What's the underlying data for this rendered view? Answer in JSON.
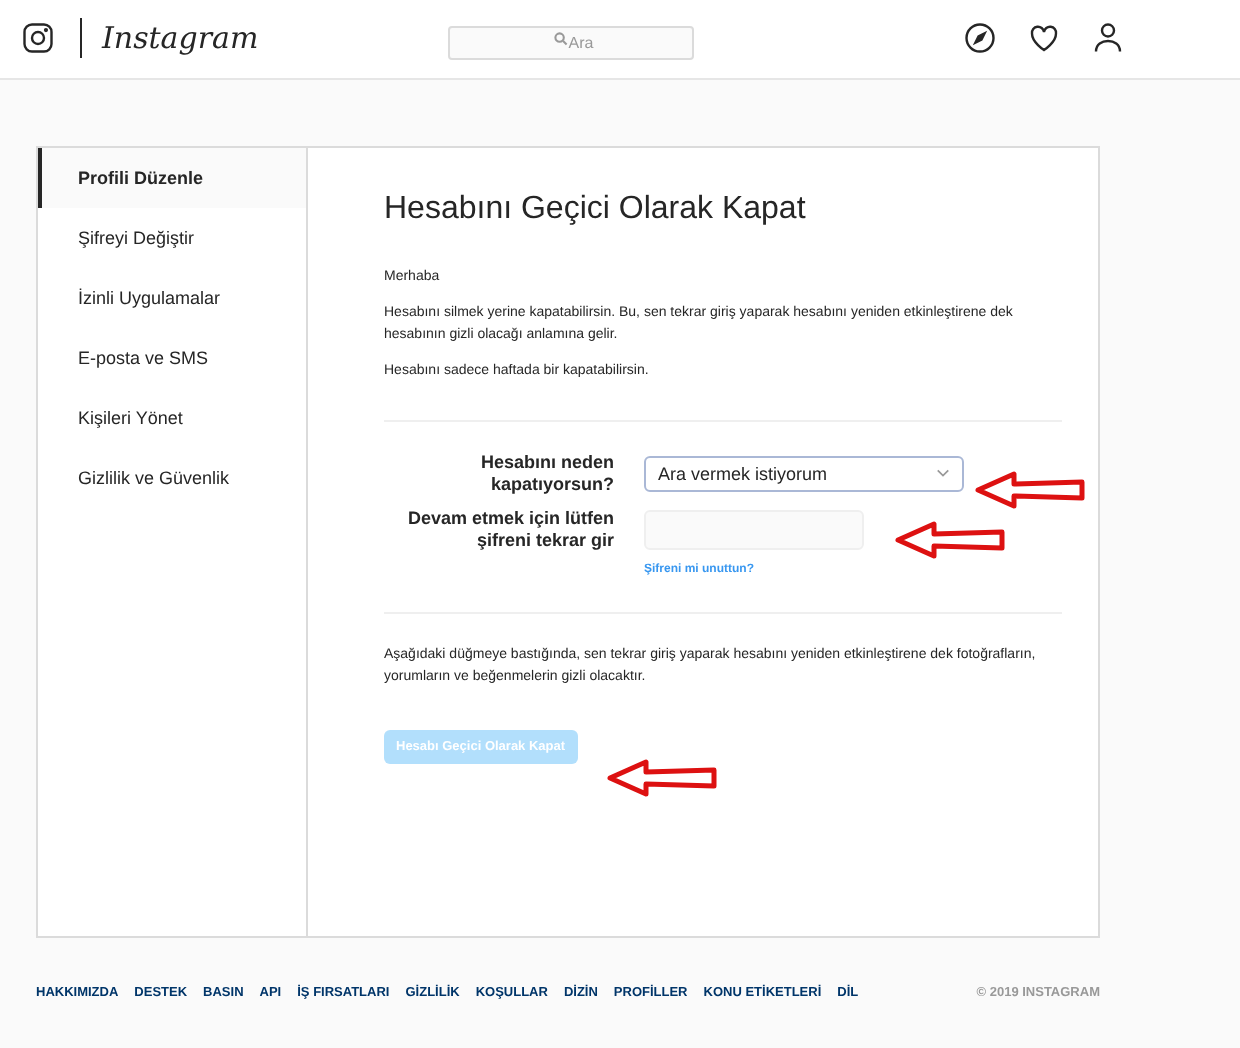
{
  "header": {
    "logo": "Instagram",
    "search": {
      "placeholder": "Ara"
    }
  },
  "sidebar": {
    "items": [
      {
        "label": "Profili Düzenle",
        "selected": true
      },
      {
        "label": "Şifreyi Değiştir",
        "selected": false
      },
      {
        "label": "İzinli Uygulamalar",
        "selected": false
      },
      {
        "label": "E-posta ve SMS",
        "selected": false
      },
      {
        "label": "Kişileri Yönet",
        "selected": false
      },
      {
        "label": "Gizlilik ve Güvenlik",
        "selected": false
      }
    ]
  },
  "main": {
    "title": "Hesabını Geçici Olarak Kapat",
    "greeting": "Merhaba",
    "paragraphs": [
      "Hesabını silmek yerine kapatabilirsin. Bu, sen tekrar giriş yaparak hesabını yeniden etkinleştirene dek hesabının gizli olacağı anlamına gelir.",
      "Hesabını sadece haftada bir kapatabilirsin."
    ],
    "reason": {
      "label": "Hesabını neden kapatıyorsun?",
      "value": "Ara vermek istiyorum"
    },
    "password": {
      "label": "Devam etmek için lütfen şifreni tekrar gir",
      "forgot_link": "Şifreni mi unuttun?"
    },
    "notice": "Aşağıdaki düğmeye bastığında, sen tekrar giriş yaparak hesabını yeniden etkinleştirene dek fotoğrafların, yorumların ve beğenmelerin gizli olacaktır.",
    "button": {
      "label": "Hesabı Geçici Olarak Kapat",
      "disabled": true
    }
  },
  "footer": {
    "links": [
      "HAKKIMIZDA",
      "DESTEK",
      "BASIN",
      "API",
      "İŞ FIRSATLARI",
      "GİZLİLİK",
      "KOŞULLAR",
      "DİZİN",
      "PROFİLLER",
      "KONU ETİKETLERİ",
      "DİL"
    ],
    "copyright": "© 2019 INSTAGRAM"
  }
}
